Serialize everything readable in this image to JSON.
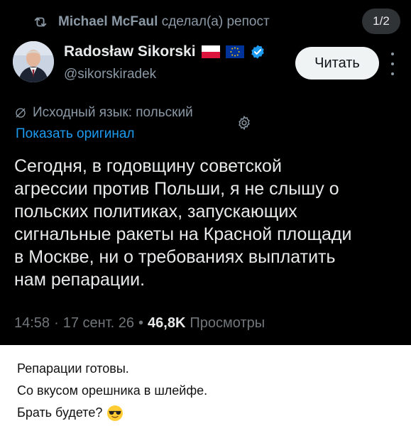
{
  "repost": {
    "name": "Michael McFaul",
    "action": "сделал(а) репост",
    "icon": "repost-icon"
  },
  "counter": "1/2",
  "author": {
    "display_name": "Radosław Sikorski",
    "handle": "@sikorskiradek",
    "badges": [
      "poland-flag",
      "eu-flag",
      "verified-badge"
    ],
    "verified_color": "#1d9bf0"
  },
  "follow_button": {
    "label": "Читать"
  },
  "translation": {
    "source_language": "Исходный язык: польский",
    "show_original": "Показать оригинал"
  },
  "tweet": {
    "text": "Сегодня, в годовщину советской\nагрессии против Польши, я не слышу о\nпольских политиках, запускающих\nсигнальные ракеты на Красной площади\nв Москве, ни о требованиях выплатить\nнам репарации."
  },
  "meta": {
    "time": "14:58",
    "separator": "·",
    "date": "17 сент. 26",
    "views_separator": "•",
    "views_count": "46,8K",
    "views_label": "Просмотры"
  },
  "caption": {
    "lines": [
      "Репарации готовы.",
      "Со вкусом орешника в шлейфе.",
      "Брать будете?"
    ],
    "emoji": "sunglasses-face-emoji"
  },
  "colors": {
    "background": "#000000",
    "text": "#e7e9ea",
    "muted": "#71767b",
    "link": "#1d9bf0",
    "button_bg": "#eff3f4"
  }
}
